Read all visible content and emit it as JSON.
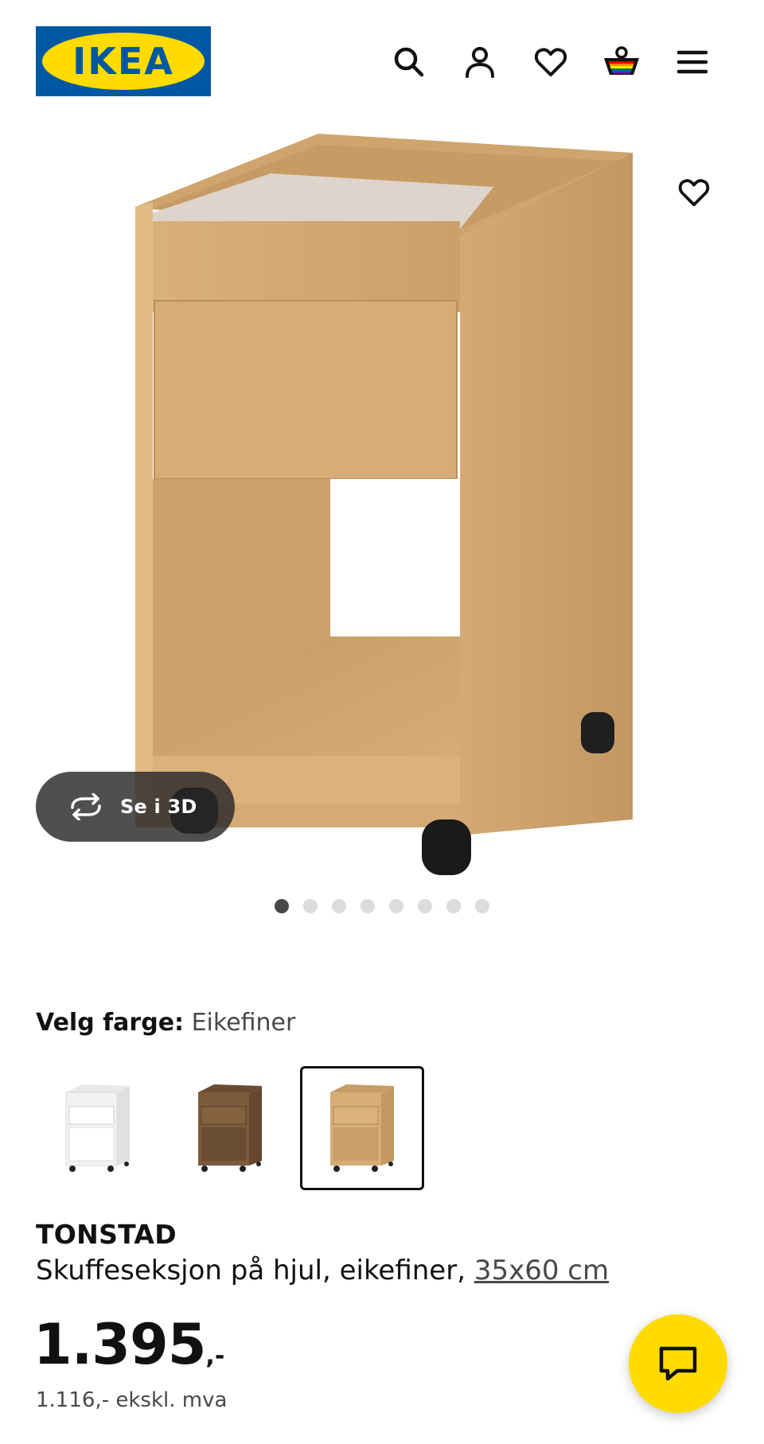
{
  "header": {
    "brand": "IKEA",
    "icons": [
      "search-icon",
      "account-icon",
      "heart-icon",
      "basket-icon",
      "menu-icon"
    ]
  },
  "gallery": {
    "view_3d_label": "Se i 3D",
    "image_count": 8,
    "active_index": 0
  },
  "color_picker": {
    "label": "Velg farge:",
    "selected_value": "Eikefiner",
    "selected_index": 2,
    "swatches": [
      "white",
      "walnut",
      "oak"
    ]
  },
  "product": {
    "name": "TONSTAD",
    "description": "Skuffeseksjon på hjul, eikefiner,",
    "size": "35x60 cm",
    "price_int": "1.395",
    "price_suffix": ",-",
    "price_ex_vat": "1.116,- ekskl. mva"
  },
  "colors": {
    "brand_blue": "#0058a3",
    "brand_yellow": "#ffdb00",
    "text": "#111111",
    "muted": "#484848"
  }
}
